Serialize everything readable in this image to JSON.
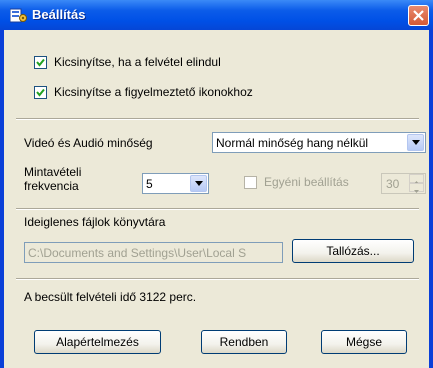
{
  "window": {
    "title": "Beállítás"
  },
  "options": {
    "minimize_on_start": {
      "label": "Kicsinyítse, ha a felvétel elindul",
      "checked": true
    },
    "minimize_to_warning_icons": {
      "label": "Kicsinyítse a figyelmeztető ikonokhoz",
      "checked": true
    }
  },
  "quality": {
    "label": "Videó és Audió minőség",
    "selected": "Normál minőség hang nélkül"
  },
  "sample_rate": {
    "label_line1": "Mintavételi",
    "label_line2": "frekvencia",
    "selected": "5",
    "custom_label": "Egyéni beállítás",
    "custom_checked": false,
    "custom_value": "30"
  },
  "temp_dir": {
    "label": "Ideiglenes fájlok könyvtára",
    "value": "C:\\Documents and Settings\\User\\Local S",
    "browse_label": "Tallózás..."
  },
  "estimate": {
    "text": "A becsült felvételi idő 3122 perc."
  },
  "buttons": {
    "defaults": "Alapértelmezés",
    "ok": "Rendben",
    "cancel": "Mégse"
  },
  "colors": {
    "titlebar": "#0b5ce9",
    "dialog_bg": "#ece9d8",
    "close_button": "#d45a35"
  }
}
